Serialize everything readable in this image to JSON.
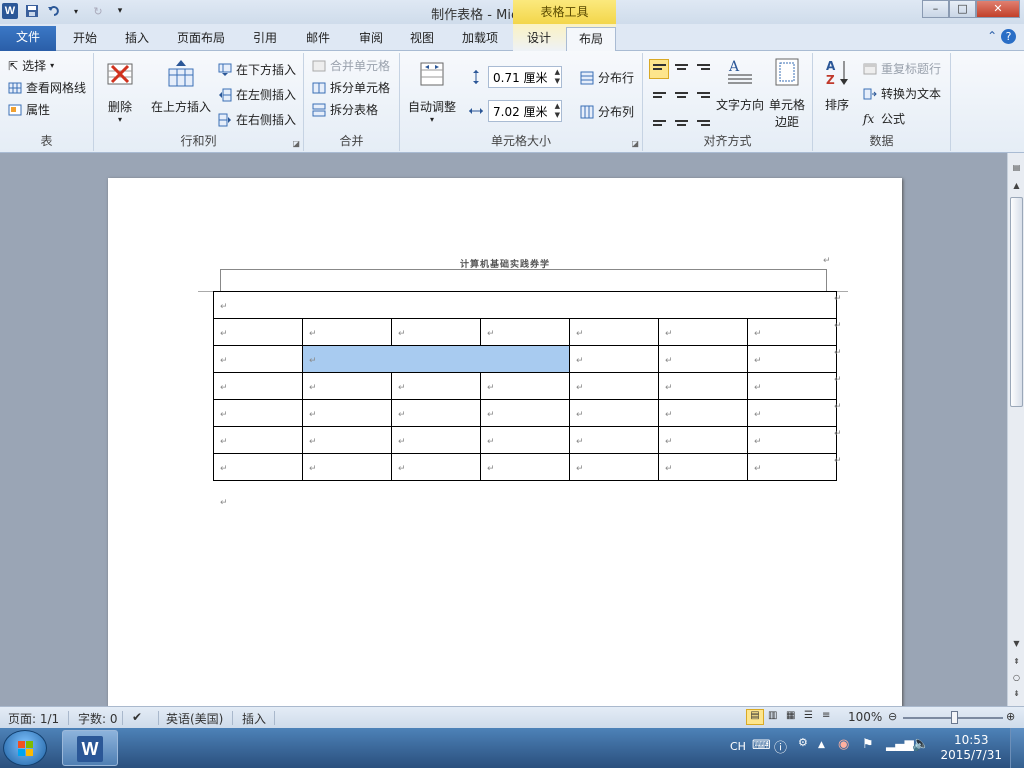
{
  "window": {
    "title": "制作表格 - Microsoft Word",
    "context_tab_group": "表格工具",
    "minimize_label": "–",
    "restore_label": "□",
    "close_label": "✕",
    "help_label": "?"
  },
  "tabs": {
    "file": "文件",
    "items": [
      "开始",
      "插入",
      "页面布局",
      "引用",
      "邮件",
      "审阅",
      "视图",
      "加载项",
      "设计",
      "布局"
    ],
    "active": "布局"
  },
  "ribbon": {
    "table_group": {
      "label": "表",
      "select": "选择",
      "gridlines": "查看网格线",
      "properties": "属性"
    },
    "rows_cols_group": {
      "label": "行和列",
      "delete": "删除",
      "insert_above": "在上方插入",
      "insert_below": "在下方插入",
      "insert_left": "在左侧插入",
      "insert_right": "在右侧插入"
    },
    "merge_group": {
      "label": "合并",
      "merge_cells": "合并单元格",
      "split_cells": "拆分单元格",
      "split_table": "拆分表格"
    },
    "cell_size_group": {
      "label": "单元格大小",
      "autofit": "自动调整",
      "height_value": "0.71 厘米",
      "width_value": "7.02 厘米",
      "distribute_rows": "分布行",
      "distribute_cols": "分布列"
    },
    "alignment_group": {
      "label": "对齐方式",
      "text_direction": "文字方向",
      "cell_margins_line1": "单元格",
      "cell_margins_line2": "边距"
    },
    "data_group": {
      "label": "数据",
      "sort": "排序",
      "repeat_header": "重复标题行",
      "convert_text": "转换为文本",
      "formula": "公式"
    }
  },
  "document": {
    "title_text": "计算机基础实践券学",
    "para_mark": "↵",
    "cell_mark": "↵",
    "table": {
      "rows": 7,
      "cols": 7,
      "selected": {
        "row": 2,
        "col_from": 1,
        "col_to": 3
      }
    }
  },
  "statusbar": {
    "page": "页面: 1/1",
    "words": "字数: 0",
    "language": "英语(美国)",
    "mode": "插入",
    "zoom": "100%",
    "zoom_level_percent": 100
  },
  "taskbar": {
    "lang": "CH",
    "time": "10:53",
    "date": "2015/7/31"
  },
  "colors": {
    "accent": "#2b5797",
    "selection": "#a8cbf0",
    "context_tab": "#f3d64b"
  }
}
